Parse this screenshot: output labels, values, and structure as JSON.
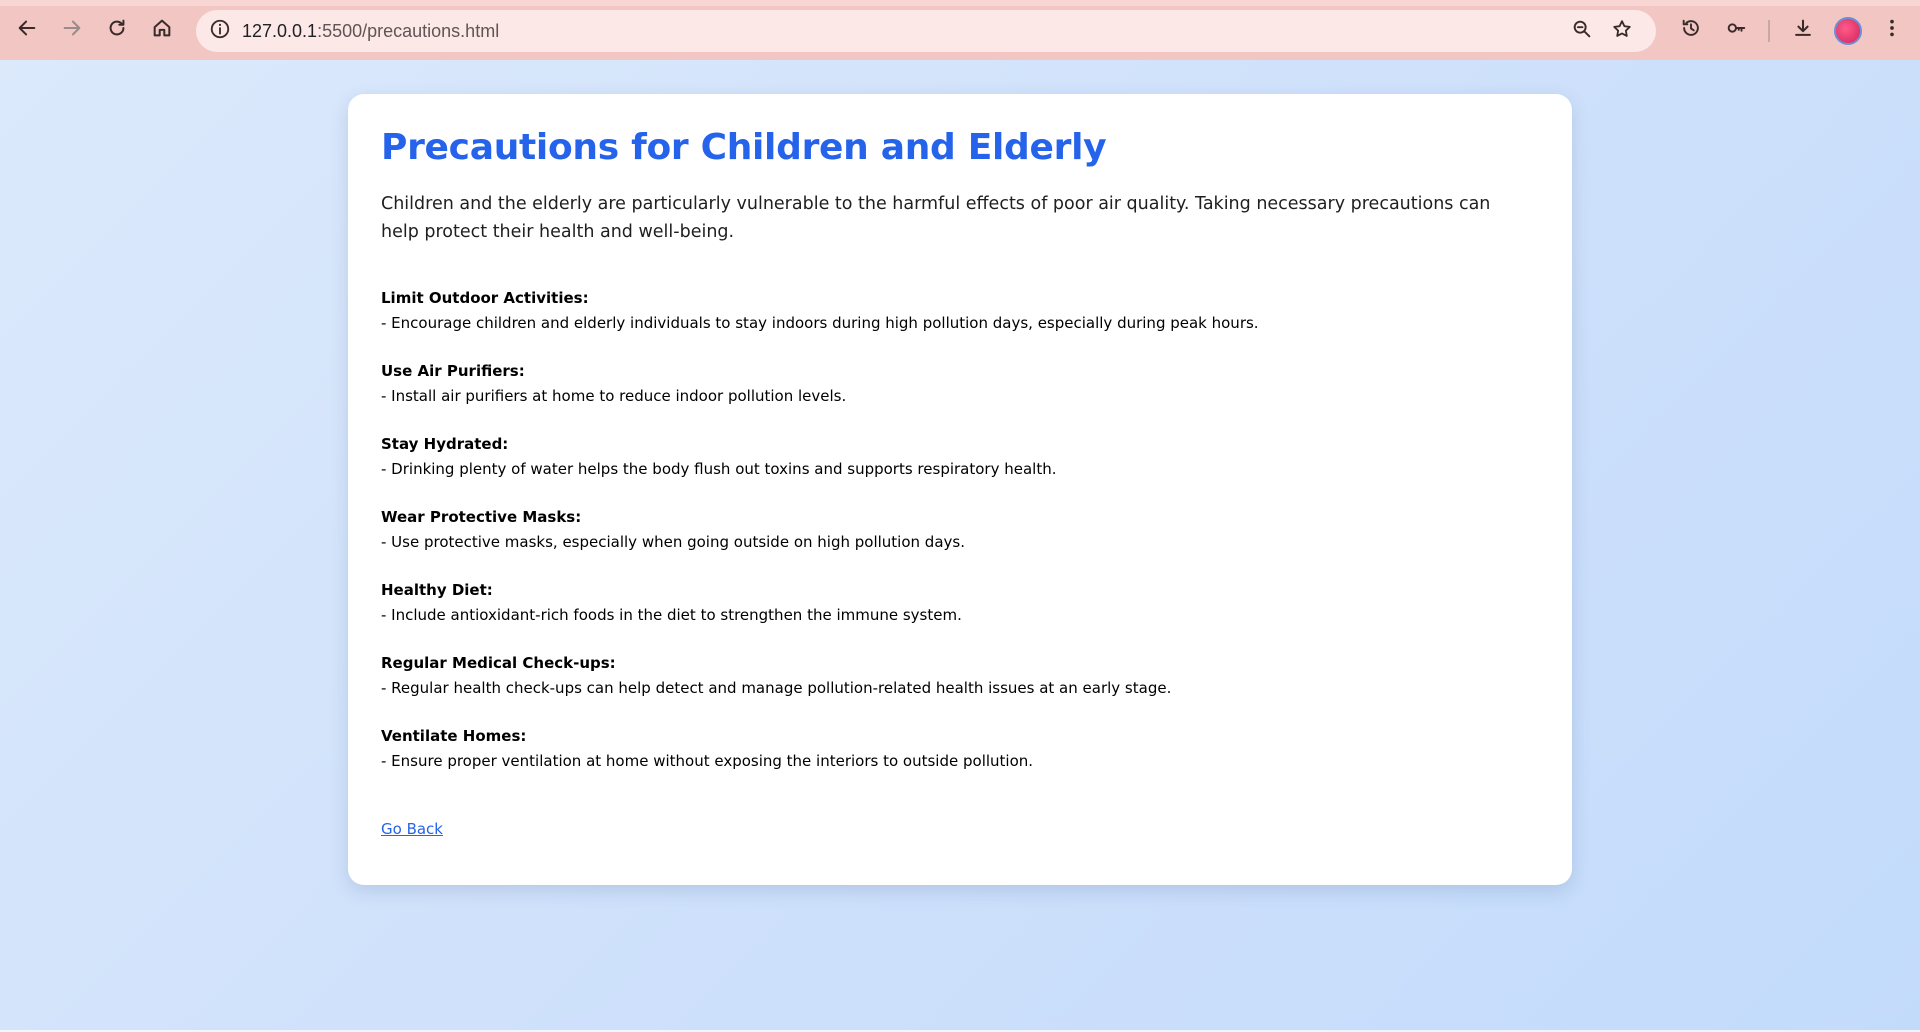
{
  "browser": {
    "url_host": "127.0.0.1",
    "url_rest": ":5500/precautions.html",
    "icons": {
      "back": "arrow-left-icon",
      "forward": "arrow-right-icon",
      "reload": "reload-icon",
      "home": "home-icon",
      "site_info": "info-icon",
      "zoom": "zoom-icon",
      "bookmark": "star-icon",
      "history": "history-icon",
      "passwords": "key-icon",
      "downloads": "download-icon",
      "menu": "kebab-menu-icon"
    },
    "colors": {
      "toolbar": "#f2c6c3",
      "omnibox": "#fbe8e7"
    }
  },
  "page": {
    "title": "Precautions for Children and Elderly",
    "intro": "Children and the elderly are particularly vulnerable to the harmful effects of poor air quality. Taking necessary precautions can help protect their health and well-being.",
    "tips": [
      {
        "title": "Limit Outdoor Activities:",
        "text": "- Encourage children and elderly individuals to stay indoors during high pollution days, especially during peak hours."
      },
      {
        "title": "Use Air Purifiers:",
        "text": "- Install air purifiers at home to reduce indoor pollution levels."
      },
      {
        "title": "Stay Hydrated:",
        "text": "- Drinking plenty of water helps the body flush out toxins and supports respiratory health."
      },
      {
        "title": "Wear Protective Masks:",
        "text": "- Use protective masks, especially when going outside on high pollution days."
      },
      {
        "title": "Healthy Diet:",
        "text": "- Include antioxidant-rich foods in the diet to strengthen the immune system."
      },
      {
        "title": "Regular Medical Check-ups:",
        "text": "- Regular health check-ups can help detect and manage pollution-related health issues at an early stage."
      },
      {
        "title": "Ventilate Homes:",
        "text": "- Ensure proper ventilation at home without exposing the interiors to outside pollution."
      }
    ],
    "go_back": "Go Back",
    "colors": {
      "heading": "#2563eb",
      "link": "#2563eb",
      "background": "#cfe1fb"
    }
  }
}
